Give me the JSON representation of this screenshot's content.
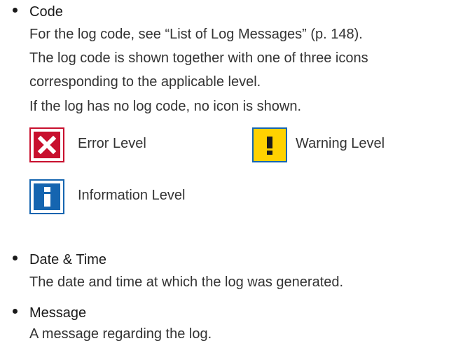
{
  "code": {
    "title": "Code",
    "lines": [
      "For the log code, see “List of Log Messages” (p. 148).",
      "The log code is shown together with one of three icons",
      "corresponding to the applicable level.",
      "If the log has no log code, no icon is shown."
    ],
    "levels": {
      "error": {
        "label": "Error Level",
        "icon": "error-icon",
        "color": "#c8102e"
      },
      "warning": {
        "label": "Warning Level",
        "icon": "warning-icon",
        "color": "#ffd200"
      },
      "information": {
        "label": "Information Level",
        "icon": "information-icon",
        "color": "#1565b0"
      }
    }
  },
  "date_time": {
    "title": "Date & Time",
    "line": "The date and time at which the log was generated."
  },
  "message": {
    "title": "Message",
    "line": "A message regarding the log."
  }
}
